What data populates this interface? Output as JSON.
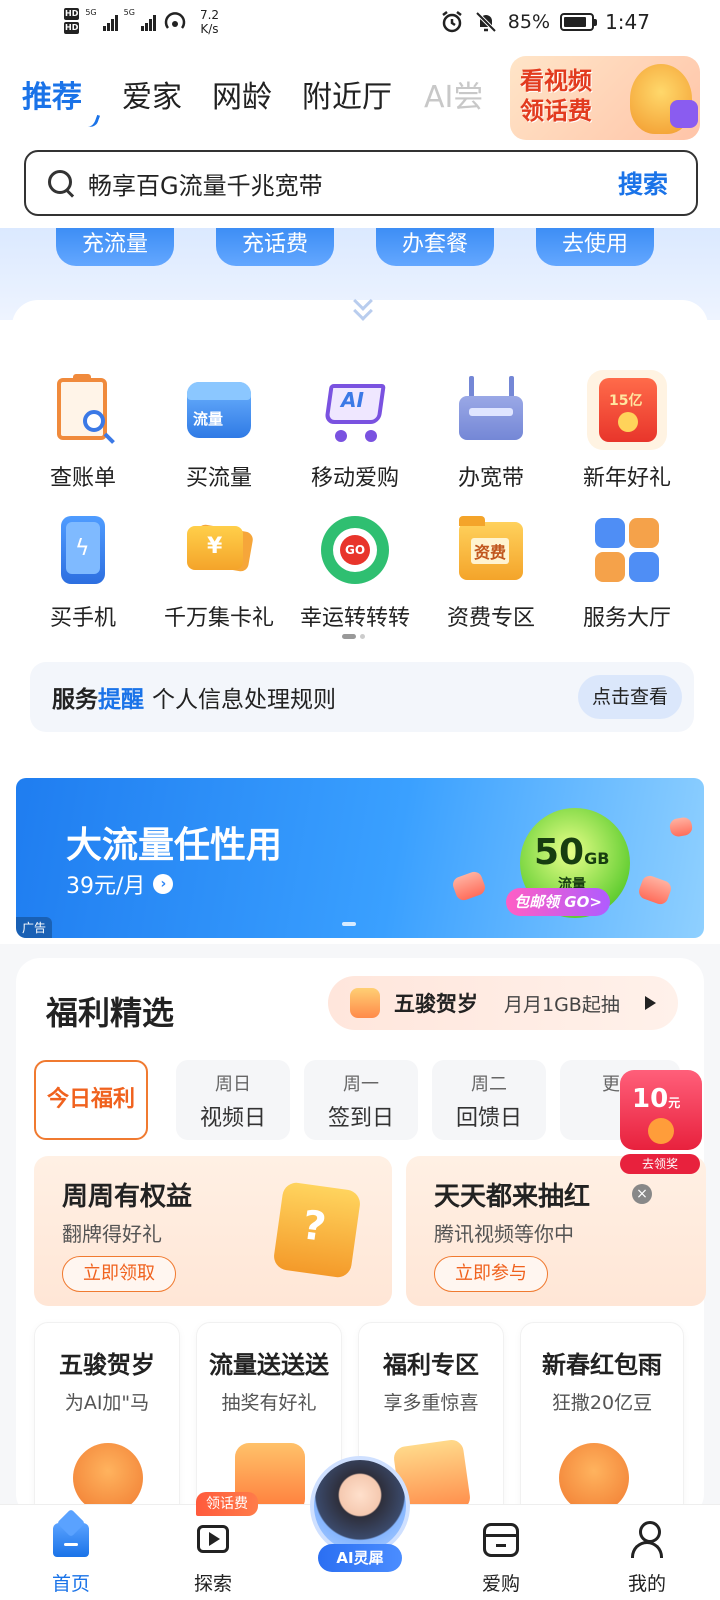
{
  "status_bar": {
    "hd1": "HD",
    "hd2": "HD",
    "net1": "5G",
    "net2": "5G",
    "speed_value": "7.2",
    "speed_unit": "K/s",
    "battery_pct": "85%",
    "battery_level": 0.85,
    "time": "1:47"
  },
  "top_tabs": {
    "items": [
      {
        "label": "推荐",
        "active": true
      },
      {
        "label": "爱家"
      },
      {
        "label": "网龄"
      },
      {
        "label": "附近厅"
      },
      {
        "label": "AI尝"
      }
    ],
    "promo": {
      "line1": "看视频",
      "line2": "领话费"
    }
  },
  "search": {
    "placeholder": "畅享百G流量千兆宽带",
    "button": "搜索"
  },
  "quick_actions": [
    "充流量",
    "充话费",
    "办套餐",
    "去使用"
  ],
  "grid": {
    "items": [
      {
        "label": "查账单",
        "icon": "bill-search-icon"
      },
      {
        "label": "买流量",
        "icon": "data-store-icon",
        "tag": "流量"
      },
      {
        "label": "移动爱购",
        "icon": "ai-cart-icon",
        "tag": "AI"
      },
      {
        "label": "办宽带",
        "icon": "router-icon"
      },
      {
        "label": "新年好礼",
        "icon": "gift-envelope-icon",
        "tag": "15亿"
      },
      {
        "label": "买手机",
        "icon": "phone-icon"
      },
      {
        "label": "千万集卡礼",
        "icon": "card-collect-icon"
      },
      {
        "label": "幸运转转转",
        "icon": "lucky-wheel-icon",
        "tag": "GO"
      },
      {
        "label": "资费专区",
        "icon": "fee-folder-icon",
        "tag": "资费"
      },
      {
        "label": "服务大厅",
        "icon": "service-hall-icon"
      }
    ],
    "notice": {
      "title_a": "服务",
      "title_b": "提醒",
      "text": "个人信息处理规则",
      "button": "点击查看"
    }
  },
  "banner": {
    "title": "大流量任性用",
    "subtitle": "39元/月",
    "ad_label": "广告",
    "ball_value": "50",
    "ball_unit": "GB",
    "ball_sub": "流量",
    "ball_tag": "包邮领 GO>"
  },
  "welfare": {
    "title": "福利精选",
    "pill": {
      "main": "五骏贺岁",
      "sub": "月月1GB起抽"
    },
    "day_tabs": [
      {
        "label": "今日福利",
        "active": true
      },
      {
        "top": "周日",
        "bottom": "视频日"
      },
      {
        "top": "周一",
        "bottom": "签到日"
      },
      {
        "top": "周二",
        "bottom": "回馈日"
      },
      {
        "top": "更多"
      }
    ],
    "floating_reward": {
      "amount": "10",
      "unit": "元",
      "button": "去领奖"
    },
    "features": [
      {
        "title": "周周有权益",
        "subtitle": "翻牌得好礼",
        "button": "立即领取"
      },
      {
        "title": "天天都来抽红",
        "subtitle": "腾讯视频等你中",
        "button": "立即参与"
      }
    ],
    "cards": [
      {
        "title": "五骏贺岁",
        "subtitle": "为AI加\"马"
      },
      {
        "title": "流量送送送",
        "subtitle": "抽奖有好礼"
      },
      {
        "title": "福利专区",
        "subtitle": "享多重惊喜"
      },
      {
        "title": "新春红包雨",
        "subtitle": "狂撒20亿豆"
      }
    ]
  },
  "bottom_nav": {
    "items": [
      {
        "label": "首页",
        "icon": "home-icon",
        "active": true
      },
      {
        "label": "探索",
        "icon": "play-icon"
      },
      {
        "label": "爱购",
        "icon": "shop-icon"
      },
      {
        "label": "我的",
        "icon": "profile-icon"
      }
    ],
    "ai_label": "AI灵犀",
    "fee_tag": "领话费"
  },
  "colors": {
    "brand_blue": "#1a73e8",
    "accent_orange": "#f07a30"
  }
}
